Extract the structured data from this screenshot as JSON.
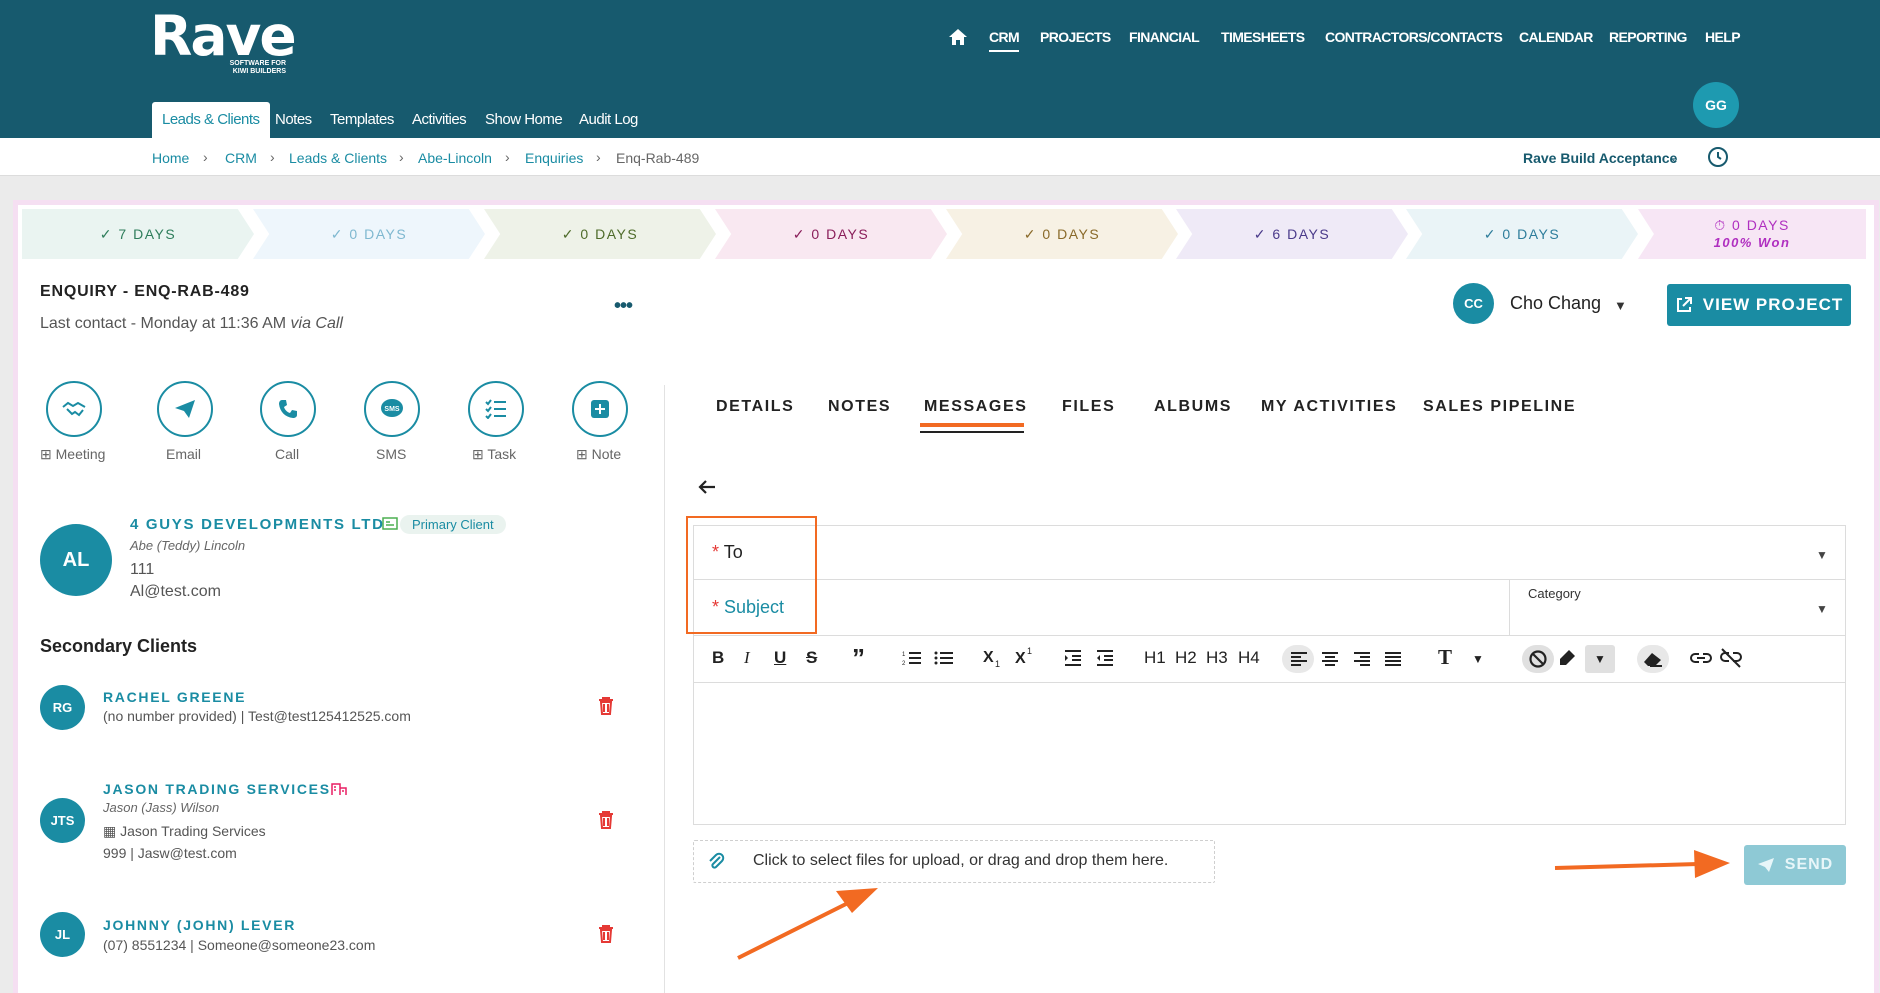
{
  "header": {
    "logo": "Rave",
    "logo_tagline_1": "SOFTWARE FOR",
    "logo_tagline_2": "KIWI BUILDERS",
    "nav": [
      "CRM",
      "PROJECTS",
      "FINANCIAL",
      "TIMESHEETS",
      "CONTRACTORS/CONTACTS",
      "CALENDAR",
      "REPORTING",
      "HELP"
    ],
    "active_nav": "CRM",
    "subtabs": [
      "Leads & Clients",
      "Notes",
      "Templates",
      "Activities",
      "Show Home",
      "Audit Log"
    ],
    "user_initials": "GG"
  },
  "breadcrumb": [
    "Home",
    "CRM",
    "Leads & Clients",
    "Abe-Lincoln",
    "Enquiries",
    "Enq-Rab-489"
  ],
  "company_selector": "Rave Build Acceptance",
  "stages": [
    {
      "label": "7 DAYS",
      "color": "#2e7d5b",
      "bg": "#eaf4f1"
    },
    {
      "label": "0 DAYS",
      "color": "#7fb8d0",
      "bg": "#eef6fc"
    },
    {
      "label": "0 DAYS",
      "color": "#4e6b2a",
      "bg": "#eef2e8"
    },
    {
      "label": "0 DAYS",
      "color": "#8a1e5a",
      "bg": "#f9e8f1"
    },
    {
      "label": "0 DAYS",
      "color": "#8a6a2a",
      "bg": "#f7f1e4"
    },
    {
      "label": "6 DAYS",
      "color": "#4a3a8a",
      "bg": "#efeaf7"
    },
    {
      "label": "0 DAYS",
      "color": "#2e7d9b",
      "bg": "#eaf4f7"
    },
    {
      "label": "0 DAYS",
      "sublabel": "100% Won",
      "color": "#b02fc0",
      "bg": "#f7e6f5"
    }
  ],
  "enquiry": {
    "title": "ENQUIRY - ENQ-RAB-489",
    "last_contact": "Last contact - Monday at 11:36 AM",
    "via": "via Call",
    "owner_initials": "CC",
    "owner_name": "Cho Chang",
    "view_project": "VIEW PROJECT"
  },
  "actions": [
    "Meeting",
    "Email",
    "Call",
    "SMS",
    "Task",
    "Note"
  ],
  "primary_client": {
    "initials": "AL",
    "company": "4 GUYS DEVELOPMENTS LTD",
    "badge": "Primary Client",
    "contact": "Abe (Teddy) Lincoln",
    "phone": "111",
    "email": "Al@test.com"
  },
  "secondary_title": "Secondary Clients",
  "secondary_clients": [
    {
      "initials": "RG",
      "name": "RACHEL GREENE",
      "line": "(no number provided)   |   Test@test125412525.com"
    },
    {
      "initials": "JTS",
      "name": "JASON TRADING SERVICES",
      "contact": "Jason (Jass) Wilson",
      "company": "Jason Trading Services",
      "line": "999   |   Jasw@test.com"
    },
    {
      "initials": "JL",
      "name": "JOHNNY (JOHN) LEVER",
      "line": "(07) 8551234   |   Someone@someone23.com"
    }
  ],
  "content_tabs": [
    "DETAILS",
    "NOTES",
    "MESSAGES",
    "FILES",
    "ALBUMS",
    "MY ACTIVITIES",
    "SALES PIPELINE"
  ],
  "active_tab": "MESSAGES",
  "form": {
    "to_label": "To",
    "subject_label": "Subject",
    "category_label": "Category",
    "upload_text": "Click to select files for upload, or drag and drop them here.",
    "send_label": "SEND"
  },
  "toolbar": [
    "B",
    "I",
    "U",
    "S",
    "”",
    "H1",
    "H2",
    "H3",
    "H4",
    "T"
  ],
  "colors": {
    "header": "#175a6e",
    "accent": "#1a8ca3",
    "highlight": "#f26a22",
    "danger": "#e53935"
  }
}
